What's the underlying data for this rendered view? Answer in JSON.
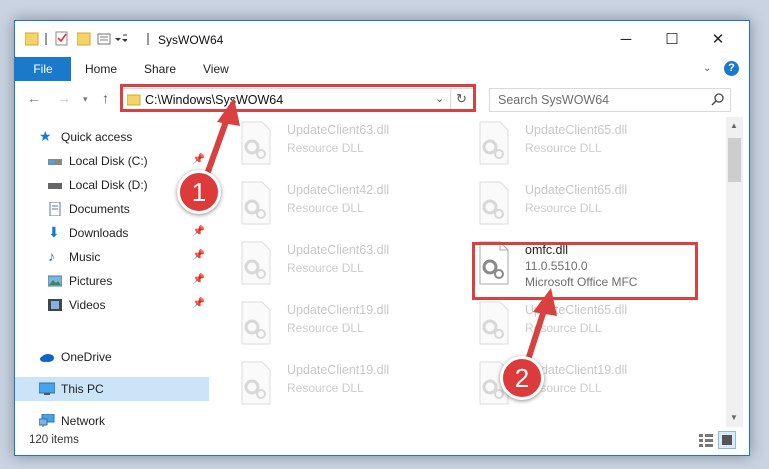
{
  "window": {
    "title": "SysWOW64",
    "minimize_glyph": "─",
    "maximize_glyph": "☐",
    "close_glyph": "✕"
  },
  "ribbon": {
    "tabs": [
      "File",
      "Home",
      "Share",
      "View"
    ]
  },
  "address": {
    "path": "C:\\Windows\\SysWOW64"
  },
  "search": {
    "placeholder": "Search SysWOW64"
  },
  "sidebar": {
    "items": [
      {
        "label": "Quick access",
        "icon": "star-icon",
        "pinned": false
      },
      {
        "label": "Local Disk (C:)",
        "icon": "drive-icon",
        "pinned": true
      },
      {
        "label": "Local Disk (D:)",
        "icon": "drive-icon",
        "pinned": false
      },
      {
        "label": "Documents",
        "icon": "document-icon",
        "pinned": false
      },
      {
        "label": "Downloads",
        "icon": "download-icon",
        "pinned": true
      },
      {
        "label": "Music",
        "icon": "music-icon",
        "pinned": true
      },
      {
        "label": "Pictures",
        "icon": "picture-icon",
        "pinned": true
      },
      {
        "label": "Videos",
        "icon": "video-icon",
        "pinned": true
      },
      {
        "label": "OneDrive",
        "icon": "cloud-icon",
        "pinned": false
      },
      {
        "label": "This PC",
        "icon": "computer-icon",
        "pinned": false,
        "selected": true
      },
      {
        "label": "Network",
        "icon": "network-icon",
        "pinned": false
      }
    ]
  },
  "files": [
    {
      "name": "UpdateClient63.dll",
      "desc": "Resource DLL"
    },
    {
      "name": "UpdateClient65.dll",
      "desc": "Resource DLL"
    },
    {
      "name": "UpdateClient42.dll",
      "desc": "Resource DLL"
    },
    {
      "name": "UpdateClient65.dll",
      "desc": "Resource DLL"
    },
    {
      "name": "UpdateClient63.dll",
      "desc": "Resource DLL"
    },
    {
      "name": "omfc.dll",
      "version": "11.0.5510.0",
      "desc": "Microsoft Office MFC",
      "selected": true
    },
    {
      "name": "UpdateClient19.dll",
      "desc": "Resource DLL"
    },
    {
      "name": "UpdateClient65.dll",
      "desc": "Resource DLL"
    },
    {
      "name": "UpdateClient19.dll",
      "desc": "Resource DLL"
    },
    {
      "name": "UpdateClient19.dll",
      "desc": "Resource DLL"
    }
  ],
  "status": {
    "item_count": "120 items"
  },
  "annotations": {
    "step1": "1",
    "step2": "2",
    "highlight_color": "#d94040"
  }
}
